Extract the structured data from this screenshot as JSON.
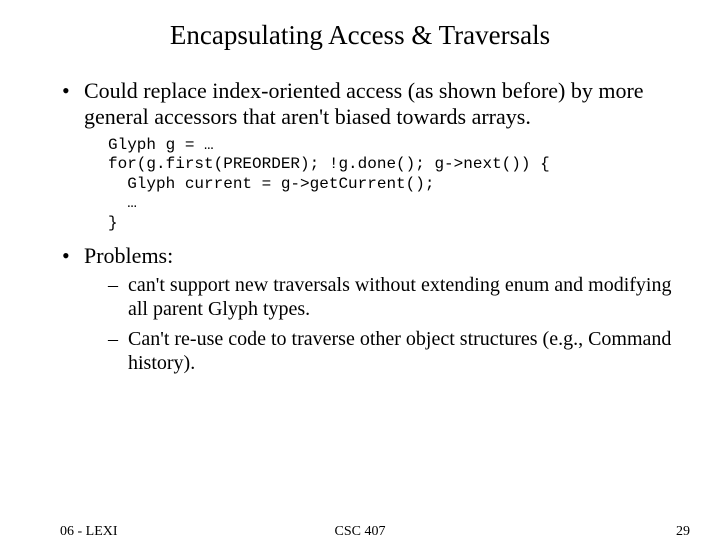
{
  "title": "Encapsulating Access & Traversals",
  "bullets": {
    "b1": "Could replace index-oriented access (as shown before) by more general accessors that aren't biased towards arrays.",
    "b2": "Problems:"
  },
  "code": "Glyph g = …\nfor(g.first(PREORDER); !g.done(); g->next()) {\n  Glyph current = g->getCurrent();\n  …\n}",
  "sub": {
    "s1": "can't support new traversals without extending enum and modifying all parent Glyph types.",
    "s2": "Can't re-use code to traverse other object structures (e.g., Command history)."
  },
  "footer": {
    "left": "06 - LEXI",
    "center": "CSC 407",
    "right": "29"
  }
}
